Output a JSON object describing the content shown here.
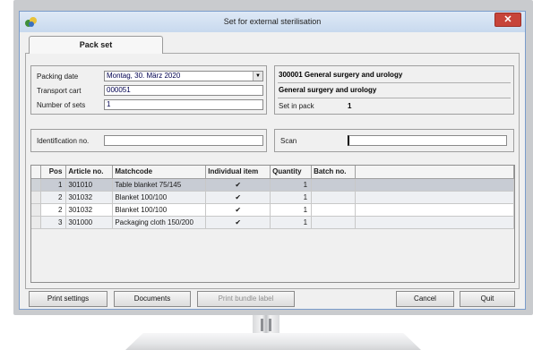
{
  "window": {
    "title": "Set for external sterilisation",
    "close_label": "✕"
  },
  "tab": {
    "label": "Pack set"
  },
  "form": {
    "packing_date_label": "Packing date",
    "packing_date_value": "Montag, 30. März 2020",
    "transport_cart_label": "Transport cart",
    "transport_cart_value": "000051",
    "number_of_sets_label": "Number of sets",
    "number_of_sets_value": "1",
    "identification_label": "Identification no.",
    "identification_value": "",
    "scan_label": "Scan",
    "scan_value": ""
  },
  "set_info": {
    "code_title": "300001   General surgery and urology",
    "name": "General surgery and urology",
    "set_in_pack_label": "Set in pack",
    "set_in_pack_value": "1"
  },
  "grid": {
    "columns": [
      "Pos",
      "Article no.",
      "Matchcode",
      "Individual item",
      "Quantity",
      "Batch no."
    ],
    "rows": [
      {
        "pos": "1",
        "article": "301010",
        "matchcode": "Table blanket 75/145",
        "individual": true,
        "quantity": "1",
        "batch": ""
      },
      {
        "pos": "2",
        "article": "301032",
        "matchcode": "Blanket 100/100",
        "individual": true,
        "quantity": "1",
        "batch": ""
      },
      {
        "pos": "2",
        "article": "301032",
        "matchcode": "Blanket 100/100",
        "individual": true,
        "quantity": "1",
        "batch": ""
      },
      {
        "pos": "3",
        "article": "301000",
        "matchcode": "Packaging cloth 150/200",
        "individual": true,
        "quantity": "1",
        "batch": ""
      }
    ]
  },
  "buttons": {
    "print_settings": "Print settings",
    "documents": "Documents",
    "print_bundle_label": "Print bundle label",
    "cancel": "Cancel",
    "quit": "Quit"
  },
  "colors": {
    "title_bar": "#c8d9ee",
    "close_button": "#c7443a",
    "selected_row": "#c8ccd4"
  }
}
